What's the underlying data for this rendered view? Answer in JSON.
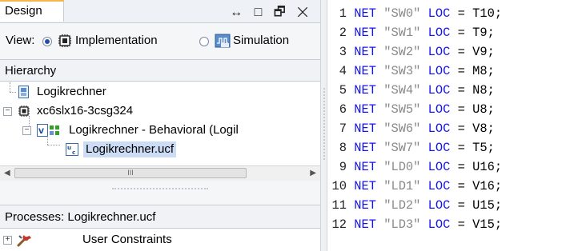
{
  "left_panel": {
    "tab": {
      "label": "Design",
      "controls": "↔ □ 🗗 ✕"
    },
    "view": {
      "label": "View:",
      "options": [
        {
          "label": "Implementation",
          "selected": true
        },
        {
          "label": "Simulation",
          "selected": false
        }
      ]
    },
    "hierarchy": {
      "title": "Hierarchy",
      "nodes": [
        {
          "label": "Logikrechner",
          "icon": "project-icon"
        },
        {
          "label": "xc6slx16-3csg324",
          "icon": "chip-icon",
          "expanded": true
        },
        {
          "label": "Logikrechner - Behavioral (Logil",
          "icon": "vhdl-module-icon",
          "expanded": true
        },
        {
          "label": "Logikrechner.ucf",
          "icon": "ucf-file-icon",
          "selected": true
        }
      ],
      "scrollbar_thumb": "III"
    },
    "processes": {
      "title": "Processes: Logikrechner.ucf",
      "items": [
        {
          "label": "User Constraints",
          "icon": "tools-icon"
        }
      ]
    }
  },
  "editor": {
    "lines": [
      {
        "n": "1",
        "kw": "NET",
        "sig": "\"SW0\"",
        "loc": "LOC",
        "eq": "=",
        "pin": "T10;"
      },
      {
        "n": "2",
        "kw": "NET",
        "sig": "\"SW1\"",
        "loc": "LOC",
        "eq": "=",
        "pin": "T9;"
      },
      {
        "n": "3",
        "kw": "NET",
        "sig": "\"SW2\"",
        "loc": "LOC",
        "eq": "=",
        "pin": "V9;"
      },
      {
        "n": "4",
        "kw": "NET",
        "sig": "\"SW3\"",
        "loc": "LOC",
        "eq": "=",
        "pin": "M8;"
      },
      {
        "n": "5",
        "kw": "NET",
        "sig": "\"SW4\"",
        "loc": "LOC",
        "eq": "=",
        "pin": "N8;"
      },
      {
        "n": "6",
        "kw": "NET",
        "sig": "\"SW5\"",
        "loc": "LOC",
        "eq": "=",
        "pin": "U8;"
      },
      {
        "n": "7",
        "kw": "NET",
        "sig": "\"SW6\"",
        "loc": "LOC",
        "eq": "=",
        "pin": "V8;"
      },
      {
        "n": "8",
        "kw": "NET",
        "sig": "\"SW7\"",
        "loc": "LOC",
        "eq": "=",
        "pin": "T5;"
      },
      {
        "n": "9",
        "kw": "NET",
        "sig": "\"LD0\"",
        "loc": "LOC",
        "eq": "=",
        "pin": "U16;"
      },
      {
        "n": "10",
        "kw": "NET",
        "sig": "\"LD1\"",
        "loc": "LOC",
        "eq": "=",
        "pin": "V16;"
      },
      {
        "n": "11",
        "kw": "NET",
        "sig": "\"LD2\"",
        "loc": "LOC",
        "eq": "=",
        "pin": "U15;"
      },
      {
        "n": "12",
        "kw": "NET",
        "sig": "\"LD3\"",
        "loc": "LOC",
        "eq": "=",
        "pin": "V15;"
      }
    ]
  },
  "colors": {
    "keyword": "#1414e6",
    "string": "#8a8a8a",
    "selection": "#ccdcf4",
    "tab_accent": "#f2b84a"
  }
}
